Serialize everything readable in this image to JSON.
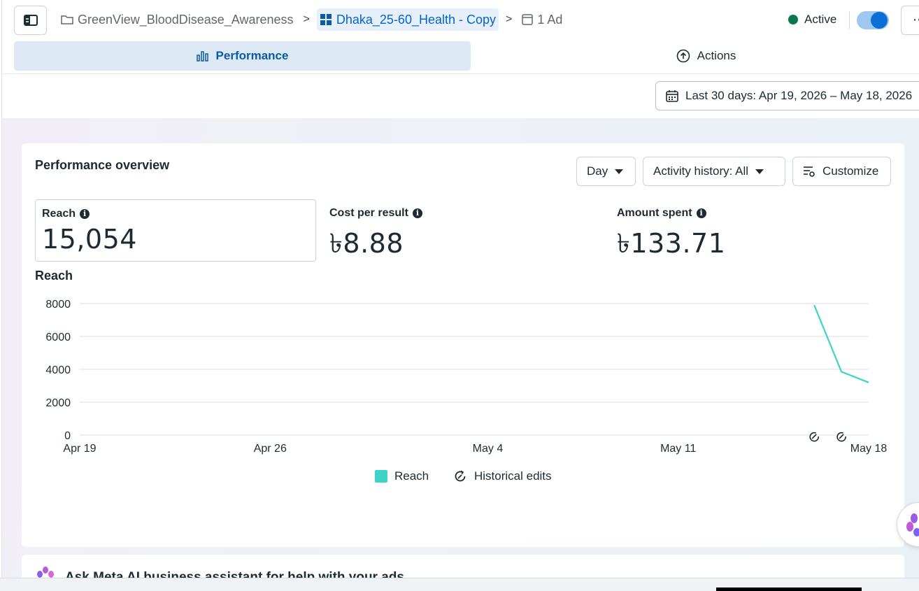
{
  "breadcrumb": {
    "campaign": "GreenView_BloodDisease_Awareness",
    "adset": "Dhaka_25-60_Health - Copy",
    "ad": "1 Ad"
  },
  "status": {
    "label": "Active",
    "toggle_on": true
  },
  "tabs": {
    "performance": "Performance",
    "actions": "Actions"
  },
  "date_range": {
    "label": "Last 30 days: Apr 19, 2026 – May 18, 2026"
  },
  "overview": {
    "title": "Performance overview",
    "granularity": "Day",
    "activity_history": "Activity history: All",
    "customize": "Customize"
  },
  "metrics": [
    {
      "label": "Reach",
      "value": "15,054"
    },
    {
      "label": "Cost per result",
      "value": "৳8.88"
    },
    {
      "label": "Amount spent",
      "value": "৳133.71"
    }
  ],
  "chart": {
    "title": "Reach"
  },
  "legend": {
    "reach": "Reach",
    "edits": "Historical edits"
  },
  "chart_data": {
    "type": "line",
    "title": "Reach",
    "y_ticks": [
      "8000",
      "6000",
      "4000",
      "2000",
      "0"
    ],
    "x_ticks": [
      "Apr 19",
      "Apr 26",
      "May 4",
      "May 11",
      "May 18"
    ],
    "ylim": [
      0,
      8000
    ],
    "grid": true,
    "legend_position": "bottom",
    "series": [
      {
        "name": "Reach",
        "color": "#3fd3c8",
        "points": [
          {
            "x": "May 16",
            "y": 7900
          },
          {
            "x": "May 17",
            "y": 3850
          },
          {
            "x": "May 18",
            "y": 3200
          }
        ]
      }
    ],
    "historical_edits": [
      "May 16",
      "May 17"
    ]
  },
  "assistant": {
    "text": "Ask Meta AI business assistant for help with your ads"
  }
}
